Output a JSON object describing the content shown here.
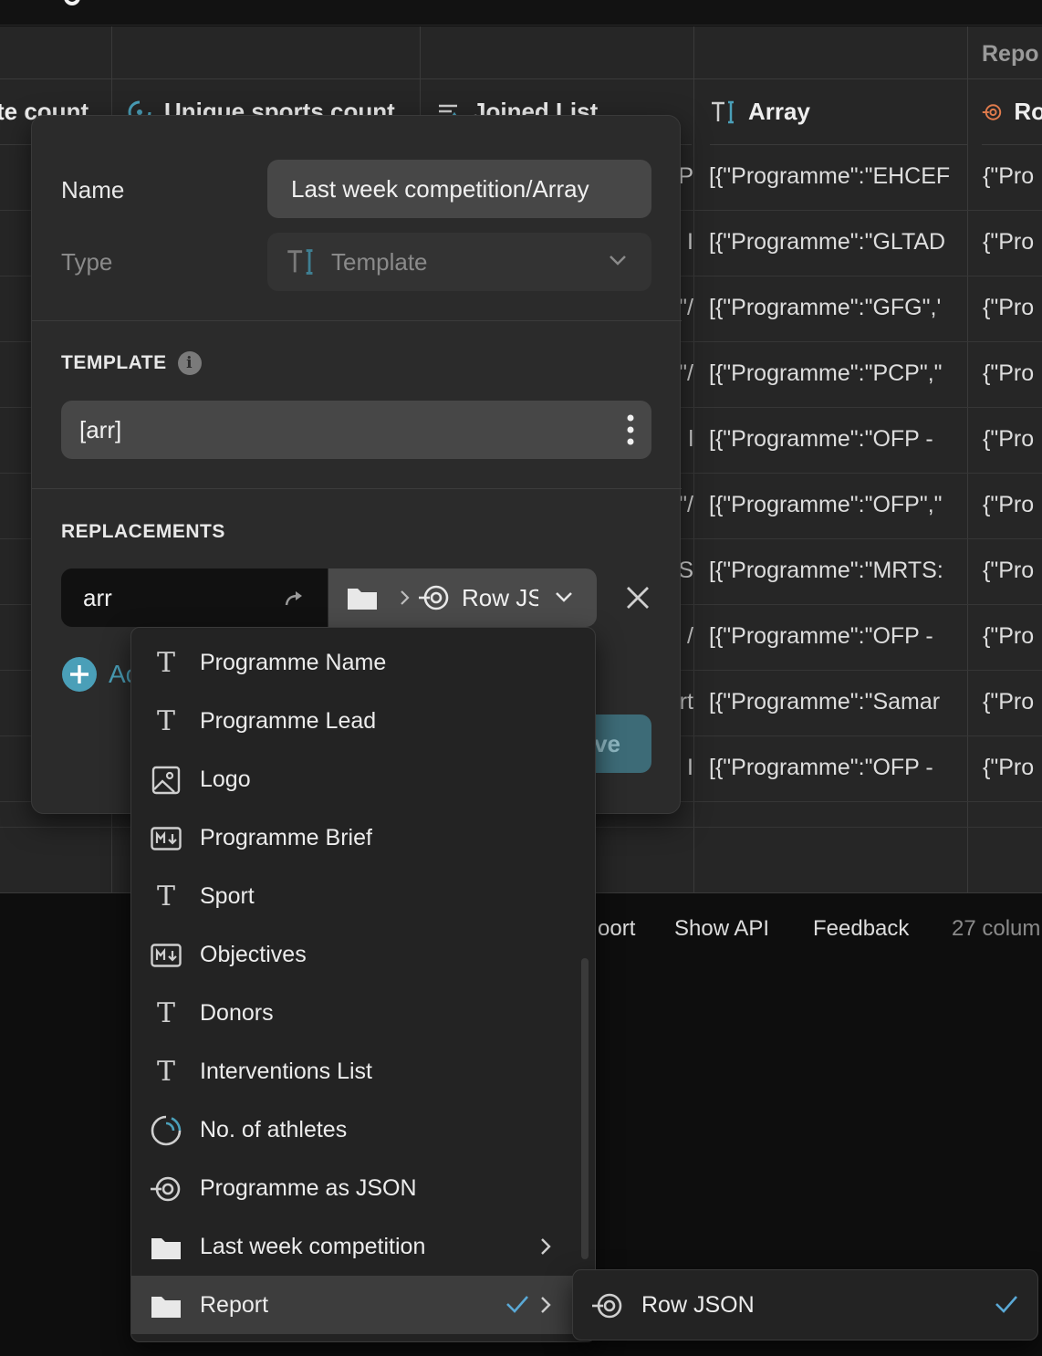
{
  "grid": {
    "group_header": "Repo",
    "columns": [
      {
        "label": "te count"
      },
      {
        "label": "Unique sports count"
      },
      {
        "label": "Joined List"
      },
      {
        "label": "Array"
      },
      {
        "label": "Ro"
      }
    ],
    "rows": [
      {
        "joined": "P",
        "array": "[{\"Programme\":\"EHCEF",
        "report": "{\"Pro"
      },
      {
        "joined": "I",
        "array": "[{\"Programme\":\"GLTAD",
        "report": "{\"Pro"
      },
      {
        "joined": "\"/",
        "array": "[{\"Programme\":\"GFG\",'",
        "report": "{\"Pro"
      },
      {
        "joined": "\"/",
        "array": "[{\"Programme\":\"PCP\",\"",
        "report": "{\"Pro"
      },
      {
        "joined": "l",
        "array": "[{\"Programme\":\"OFP -",
        "report": "{\"Pro"
      },
      {
        "joined": "\"/",
        "array": "[{\"Programme\":\"OFP\",\"",
        "report": "{\"Pro"
      },
      {
        "joined": "S",
        "array": "[{\"Programme\":\"MRTS:",
        "report": "{\"Pro"
      },
      {
        "joined": "/",
        "array": "[{\"Programme\":\"OFP -",
        "report": "{\"Pro"
      },
      {
        "joined": "rt",
        "array": "[{\"Programme\":\"Samar",
        "report": "{\"Pro"
      },
      {
        "joined": "I",
        "array": "[{\"Programme\":\"OFP -",
        "report": "{\"Pro"
      }
    ]
  },
  "footer": {
    "export_label": "oort",
    "show_api_label": "Show API",
    "feedback_label": "Feedback",
    "column_count": "27 colum"
  },
  "editor": {
    "name_label": "Name",
    "name_value": "Last week competition/Array",
    "type_label": "Type",
    "type_value": "Template",
    "template_section": "TEMPLATE",
    "template_value": "[arr]",
    "replacements_section": "REPLACEMENTS",
    "replacement_key": "arr",
    "replacement_target": "Row JS",
    "add_label": "Ac",
    "save_label": "ve"
  },
  "menu": {
    "items": [
      {
        "label": "Programme Name",
        "icon": "text-icon"
      },
      {
        "label": "Programme Lead",
        "icon": "text-icon"
      },
      {
        "label": "Logo",
        "icon": "image-icon"
      },
      {
        "label": "Programme Brief",
        "icon": "markdown-icon"
      },
      {
        "label": "Sport",
        "icon": "text-icon"
      },
      {
        "label": "Objectives",
        "icon": "markdown-icon"
      },
      {
        "label": "Donors",
        "icon": "text-icon"
      },
      {
        "label": "Interventions List",
        "icon": "text-icon"
      },
      {
        "label": "No. of athletes",
        "icon": "rollup-icon"
      },
      {
        "label": "Programme as JSON",
        "icon": "json-icon"
      },
      {
        "label": "Last week competition",
        "icon": "folder-icon"
      },
      {
        "label": "Report",
        "icon": "folder-icon"
      }
    ],
    "submenu_item": "Row JSON"
  },
  "colors": {
    "accent": "#4a9fb8",
    "check": "#5aa9d6",
    "json_icon_orange": "#e07b4c"
  }
}
